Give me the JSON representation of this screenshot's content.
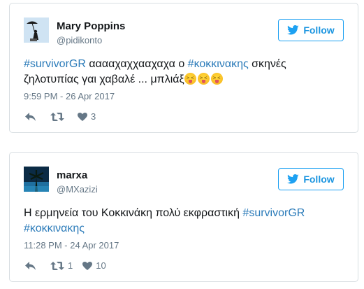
{
  "colors": {
    "accent": "#1da1f2",
    "link": "#2b7bb9",
    "muted": "#657786",
    "border": "#d8dee2"
  },
  "tweets": [
    {
      "name": "Mary Poppins",
      "handle": "@pidikonto",
      "follow_label": "Follow",
      "text_parts": [
        "#survivorGR",
        " ααααχαχχααχαχα ο ",
        "#κοκκινακης",
        " σκηνές ζηλοτυπίας γαι χαβαλέ ... μπλιάξ"
      ],
      "emoji": "squinting-face-with-tongue",
      "emoji_count": 3,
      "timestamp": "9:59 PM - 26 Apr 2017",
      "retweets": "",
      "likes": "3"
    },
    {
      "name": "marxa",
      "handle": "@MXazizi",
      "follow_label": "Follow",
      "text_parts": [
        "Η ερμηνεία του Κοκκινάκη πολύ εκφραστική ",
        "#survivorGR",
        " ",
        "#κοκκινακης"
      ],
      "timestamp": "11:28 PM - 24 Apr 2017",
      "retweets": "1",
      "likes": "10"
    }
  ]
}
